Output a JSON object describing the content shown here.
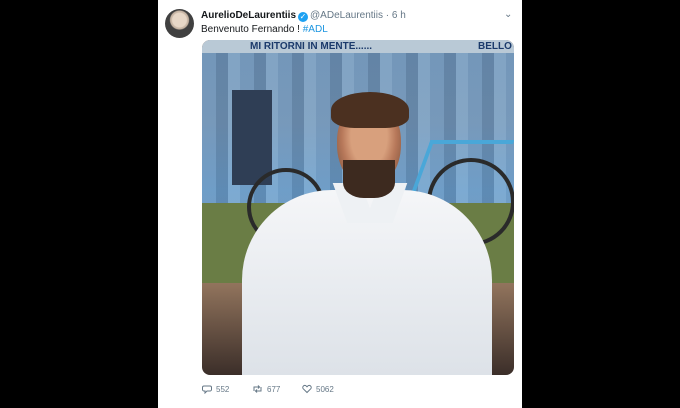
{
  "tweet": {
    "display_name": "AurelioDeLaurentiis",
    "handle": "@ADeLaurentiis",
    "separator": "·",
    "time": "6 h",
    "text": "Benvenuto Fernando ! ",
    "hashtag": "#ADL"
  },
  "photo": {
    "banner_text": "MI RITORNI IN MENTE......",
    "banner_text_right": "BELLO"
  },
  "actions": {
    "replies": "552",
    "retweets": "677",
    "likes": "5062"
  },
  "colors": {
    "link": "#1b95e0",
    "verified": "#1da1f2",
    "secondary_text": "#657786"
  },
  "icons": {
    "verified": "verified-badge-icon",
    "caret": "chevron-down-icon",
    "reply": "reply-icon",
    "retweet": "retweet-icon",
    "like": "heart-icon"
  }
}
